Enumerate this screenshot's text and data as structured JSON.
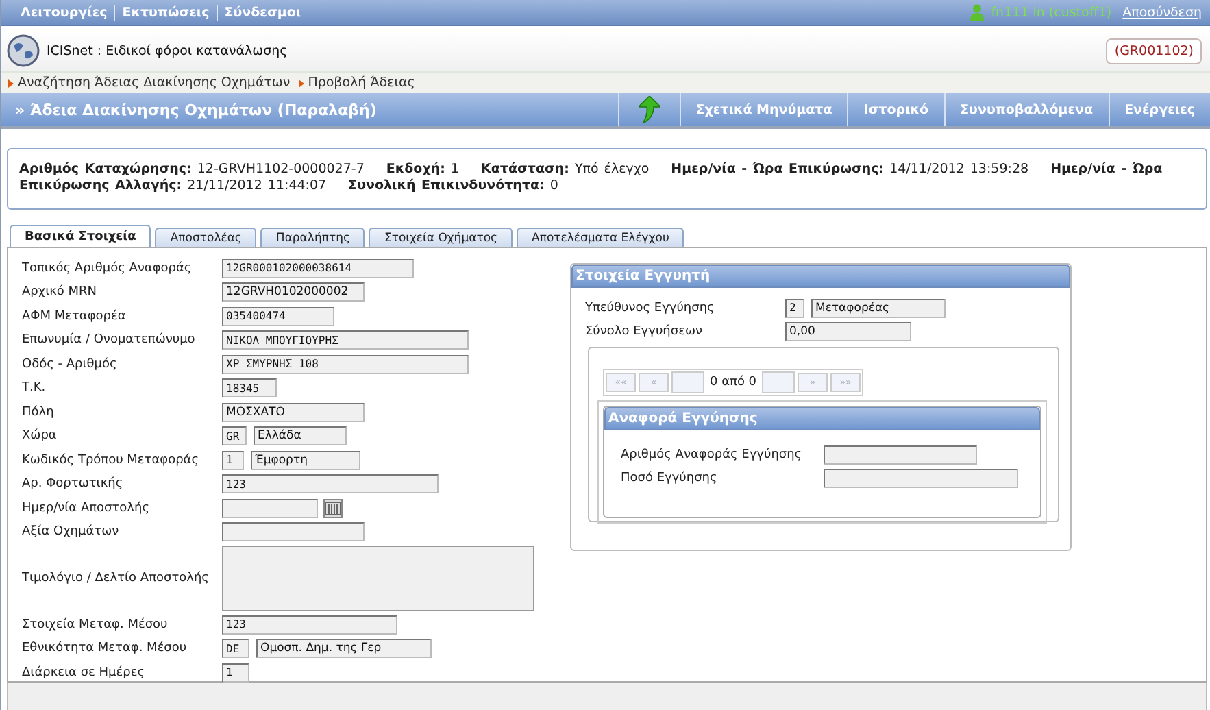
{
  "menu": [
    "Λειτουργίες",
    "Εκτυπώσεις",
    "Σύνδεσμοι"
  ],
  "user": {
    "name": "fn111 ln (custoff1)",
    "logout": "Αποσύνδεση"
  },
  "app": {
    "title": "ICISnet : Ειδικοί φόροι κατανάλωσης",
    "office": "(GR001102)"
  },
  "breadcrumb": [
    "Αναζήτηση Άδειας Διακίνησης Οχημάτων",
    "Προβολή Άδειας"
  ],
  "page_title": "» Άδεια Διακίνησης Οχημάτων (Παραλαβή)",
  "toolbar": [
    "Σχετικά Μηνύματα",
    "Ιστορικό",
    "Συνυποβαλλόμενα",
    "Ενέργειες"
  ],
  "summary": [
    {
      "label": "Αριθμός Καταχώρησης:",
      "value": "12-GRVH1102-0000027-7"
    },
    {
      "label": "Εκδοχή:",
      "value": "1"
    },
    {
      "label": "Κατάσταση:",
      "value": "Υπό έλεγχο"
    },
    {
      "label": "Ημερ/νία - Ώρα Επικύρωσης:",
      "value": "14/11/2012 13:59:28"
    },
    {
      "label": "Ημερ/νία - Ώρα Επικύρωσης Αλλαγής:",
      "value": "21/11/2012 11:44:07"
    },
    {
      "label": "Συνολική Επικινδυνότητα:",
      "value": "0"
    }
  ],
  "tabs": [
    {
      "label": "Βασικά Στοιχεία",
      "selected": true
    },
    {
      "label": "Αποστολέας",
      "selected": false
    },
    {
      "label": "Παραλήπτης",
      "selected": false
    },
    {
      "label": "Στοιχεία Οχήματος",
      "selected": false
    },
    {
      "label": "Αποτελέσματα Ελέγχου",
      "selected": false
    }
  ],
  "fields": [
    {
      "kind": "text",
      "label": "Τοπικός Αριθμός Αναφοράς",
      "value": "12GR000102000038614"
    },
    {
      "kind": "text",
      "label": "Αρχικό MRN",
      "value": "12GRVH0102000002"
    },
    {
      "kind": "text",
      "label": "ΑΦΜ Μεταφορέα",
      "value": "035400474"
    },
    {
      "kind": "text",
      "label": "Επωνυμία / Ονοματεπώνυμο",
      "value": "ΝΙΚΟΛ ΜΠΟΥΓΙΟΥΡΗΣ"
    },
    {
      "kind": "text",
      "label": "Οδός - Αριθμός",
      "value": "ΧΡ ΣΜΥΡΝΗΣ 108"
    },
    {
      "kind": "text",
      "label": "Τ.Κ.",
      "value": "18345"
    },
    {
      "kind": "text",
      "label": "Πόλη",
      "value": "ΜΟΣΧΑΤΟ"
    },
    {
      "kind": "pair",
      "label": "Χώρα",
      "code": "GR",
      "value": "Ελλάδα"
    },
    {
      "kind": "pair",
      "label": "Κωδικός Τρόπου Μεταφοράς",
      "code": "1",
      "value": "Έμφορτη"
    },
    {
      "kind": "text",
      "label": "Αρ. Φορτωτικής",
      "value": "123"
    },
    {
      "kind": "date",
      "label": "Ημερ/νία Αποστολής"
    },
    {
      "kind": "text",
      "label": "Αξία Οχημάτων"
    },
    {
      "kind": "area",
      "label": "Τιμολόγιο / Δελτίο Αποστολής"
    },
    {
      "kind": "text",
      "label": "Στοιχεία Μεταφ. Μέσου",
      "value": "123"
    },
    {
      "kind": "pair",
      "label": "Εθνικότητα Μεταφ. Μέσου",
      "code": "DE",
      "value": "Ομοσπ. Δημ. της Γερ"
    },
    {
      "kind": "text",
      "label": "Διάρκεια σε Ημέρες",
      "value": "1"
    }
  ],
  "guarantor": {
    "title": "Στοιχεία Εγγυητή",
    "fields": [
      {
        "kind": "pair",
        "label": "Υπεύθυνος Εγγύησης",
        "code": "2",
        "value": "Μεταφορέας"
      },
      {
        "kind": "text",
        "label": "Σύνολο Εγγυήσεων",
        "value": "0,00"
      }
    ],
    "pager": {
      "buttons": [
        {
          "label": "««",
          "disabled": true
        },
        {
          "label": "«",
          "disabled": true
        }
      ],
      "status": "0 από 0",
      "next": [
        {
          "label": "»",
          "disabled": true
        },
        {
          "label": "»»",
          "disabled": true
        }
      ]
    },
    "reference": {
      "title": "Αναφορά Εγγύησης",
      "fields": [
        {
          "kind": "text",
          "label": "Αριθμός Αναφοράς Εγγύησης"
        },
        {
          "kind": "text",
          "label": "Ποσό Εγγύησης"
        }
      ]
    }
  }
}
